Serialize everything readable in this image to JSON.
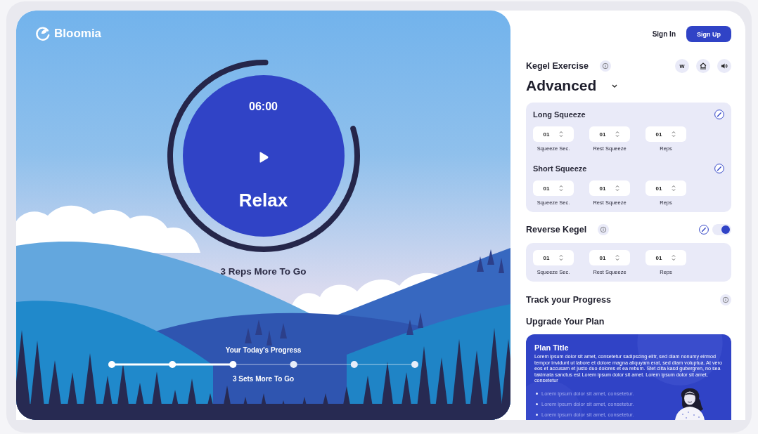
{
  "brand": {
    "name": "Bloomia"
  },
  "timer": {
    "time": "06:00",
    "phase": "Relax",
    "level": 0.8,
    "caption": "3 Reps More To Go"
  },
  "progress": {
    "title": "Your Today's Progress",
    "sets": [
      {
        "done": true
      },
      {
        "done": true
      },
      {
        "done": true
      },
      {
        "done": false
      },
      {
        "done": false
      },
      {
        "done": false
      }
    ],
    "caption": "3 Sets More To Go"
  },
  "auth": {
    "sign_in": "Sign In",
    "sign_up": "Sign Up"
  },
  "exercise": {
    "title": "Kegel Exercise",
    "tools": [
      {
        "kind": "letter",
        "label": "w"
      },
      {
        "kind": "house"
      },
      {
        "kind": "speaker"
      }
    ],
    "difficulty": "Advanced"
  },
  "squeezes": [
    {
      "title": "Long Squeeze",
      "fields": [
        {
          "label": "Squeeze Sec.",
          "value": "01"
        },
        {
          "label": "Rest Squeeze",
          "value": "01"
        },
        {
          "label": "Reps",
          "value": "01"
        }
      ]
    },
    {
      "title": "Short Squeeze",
      "fields": [
        {
          "label": "Squeeze Sec.",
          "value": "01"
        },
        {
          "label": "Rest Squeeze",
          "value": "01"
        },
        {
          "label": "Reps",
          "value": "01"
        }
      ]
    }
  ],
  "reverse_kegel": {
    "title": "Reverse Kegel",
    "on": true,
    "fields": [
      {
        "label": "Squeeze Sec.",
        "value": "01"
      },
      {
        "label": "Rest Squeeze",
        "value": "01"
      },
      {
        "label": "Reps",
        "value": "01"
      }
    ]
  },
  "track": {
    "title": "Track your Progress"
  },
  "upgrade": {
    "title": "Upgrade Your Plan",
    "plan": {
      "title": "Plan Title",
      "description": "Lorem ipsum dolor sit amet, consetetur sadipscing elitr, sed diam nonumy eirmod tempor invidunt ut labore et dolore magna aliquyam erat, sed diam voluptua. At vero eos et accusam et justo duo dolores et ea rebum. Stet clita kasd gubergren, no sea takimata sanctus est Lorem ipsum dolor sit amet. Lorem ipsum dolor sit amet, consetetur",
      "bullets": [
        "Lorem ipsum dolor sit amet, consetetur.",
        "Lorem ipsum dolor sit amet, consetetur.",
        "Lorem ipsum dolor sit amet, consetetur."
      ]
    }
  }
}
